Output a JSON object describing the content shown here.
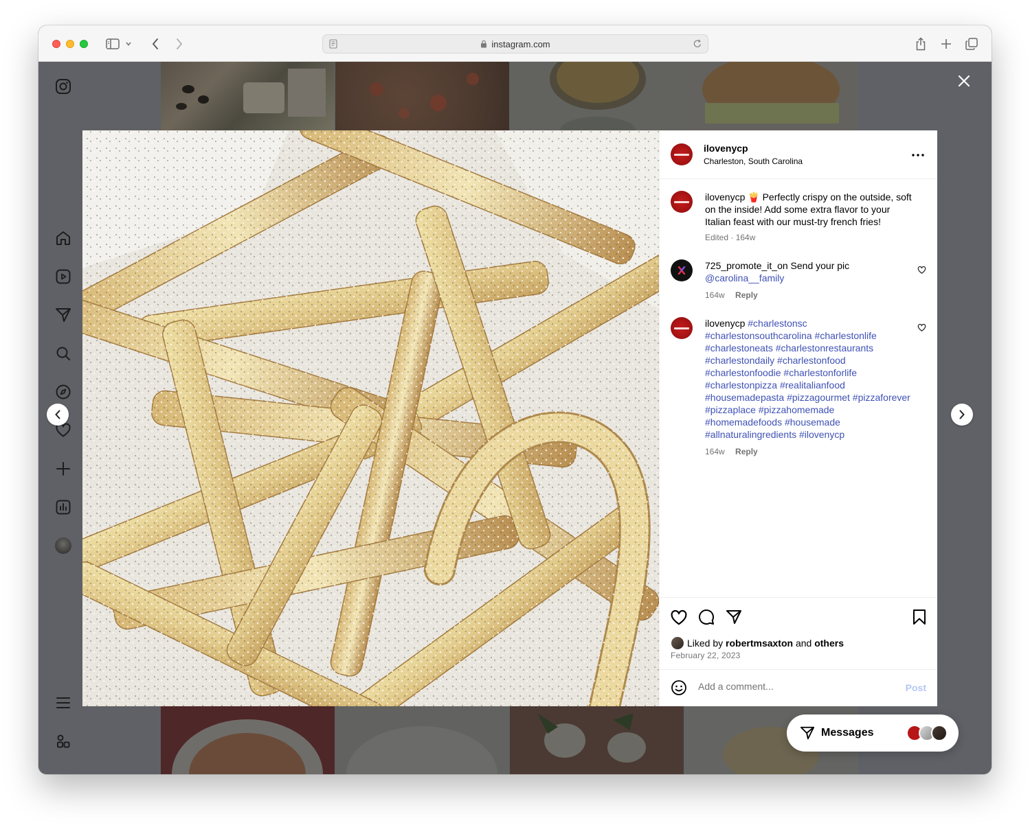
{
  "browser": {
    "url": "instagram.com"
  },
  "post": {
    "username": "ilovenycp",
    "location": "Charleston, South Carolina",
    "caption": {
      "username": "ilovenycp",
      "emoji": "🍟",
      "text": "Perfectly crispy on the outside, soft on the inside! Add some extra flavor to your Italian feast with our must-try french fries!",
      "meta": "Edited · 164w"
    },
    "comments": [
      {
        "username": "725_promote_it_on",
        "text": "Send your pic",
        "mention": "@carolina__family",
        "age": "164w",
        "reply": "Reply"
      },
      {
        "username": "ilovenycp",
        "hashtags": "#charlestonsc #charlestonsouthcarolina #charlestonlife #charlestoneats #charlestonrestaurants #charlestondaily #charlestonfood #charlestonfoodie #charlestonforlife #charlestonpizza #realitalianfood #housemadepasta #pizzagourmet #pizzaforever #pizzaplace #pizzahomemade #homemadefoods #housemade #allnaturalingredients #ilovenycp",
        "age": "164w",
        "reply": "Reply"
      }
    ],
    "likes": {
      "prefix": "Liked by",
      "user": "robertmsaxton",
      "middle": "and",
      "others": "others"
    },
    "date": "February 22, 2023",
    "comment_box": {
      "placeholder": "Add a comment...",
      "post_label": "Post"
    }
  },
  "messages": {
    "label": "Messages"
  },
  "colors": {
    "link_blue": "#3f51b5",
    "post_button_disabled": "#b3c7f5",
    "avatar_red": "#b71717"
  }
}
